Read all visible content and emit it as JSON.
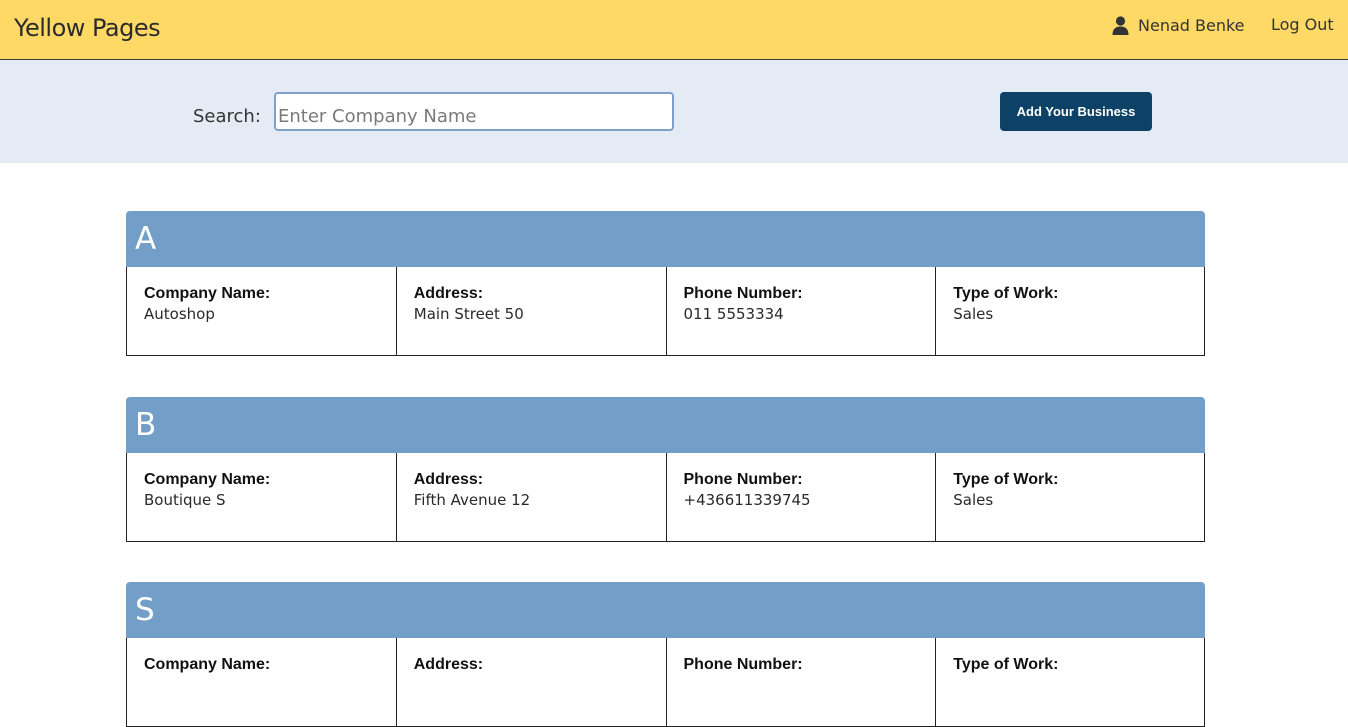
{
  "header": {
    "brand": "Yellow Pages",
    "user_name": "Nenad Benke",
    "logout_label": "Log Out"
  },
  "search": {
    "label": "Search:",
    "placeholder": "Enter Company Name",
    "value": ""
  },
  "actions": {
    "add_business_label": "Add Your Business"
  },
  "field_labels": {
    "company": "Company Name:",
    "address": "Address:",
    "phone": "Phone Number:",
    "type": "Type of Work:"
  },
  "sections": [
    {
      "letter": "A",
      "company": "Autoshop",
      "address": "Main Street 50",
      "phone": "011 5553334",
      "type": "Sales"
    },
    {
      "letter": "B",
      "company": "Boutique S",
      "address": "Fifth Avenue 12",
      "phone": "+436611339745",
      "type": "Sales"
    },
    {
      "letter": "S",
      "company": "",
      "address": "",
      "phone": "",
      "type": ""
    }
  ],
  "colors": {
    "topbar": "#ffd966",
    "search_band": "#e4ebf5",
    "section_header": "#739ec7",
    "primary_button": "#0d4166"
  },
  "icons": {
    "user": "user-icon"
  }
}
